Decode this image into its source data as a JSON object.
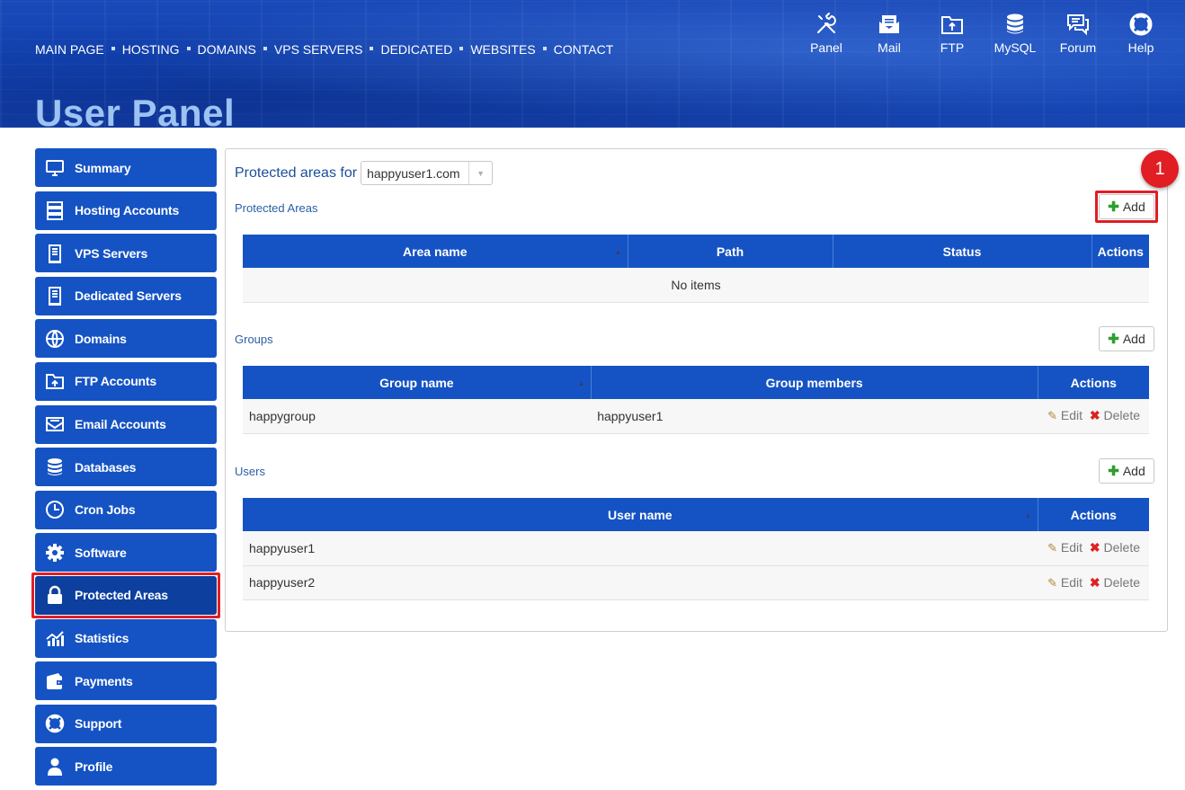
{
  "nav": {
    "items": [
      "MAIN PAGE",
      "HOSTING",
      "DOMAINS",
      "VPS SERVERS",
      "DEDICATED",
      "WEBSITES",
      "CONTACT"
    ]
  },
  "quick_links": {
    "panel": "Panel",
    "mail": "Mail",
    "ftp": "FTP",
    "mysql": "MySQL",
    "forum": "Forum",
    "help": "Help"
  },
  "page_title": "User Panel",
  "sidebar": {
    "items": [
      {
        "label": "Summary",
        "icon": "monitor-icon"
      },
      {
        "label": "Hosting Accounts",
        "icon": "server-stack-icon"
      },
      {
        "label": "VPS Servers",
        "icon": "server-tower-icon"
      },
      {
        "label": "Dedicated Servers",
        "icon": "server-tower-icon"
      },
      {
        "label": "Domains",
        "icon": "www-globe-icon"
      },
      {
        "label": "FTP Accounts",
        "icon": "folder-icon"
      },
      {
        "label": "Email Accounts",
        "icon": "envelope-icon"
      },
      {
        "label": "Databases",
        "icon": "database-icon"
      },
      {
        "label": "Cron Jobs",
        "icon": "clock-icon"
      },
      {
        "label": "Software",
        "icon": "gear-icon"
      },
      {
        "label": "Protected Areas",
        "icon": "lock-icon",
        "active": true
      },
      {
        "label": "Statistics",
        "icon": "chart-icon"
      },
      {
        "label": "Payments",
        "icon": "wallet-icon"
      },
      {
        "label": "Support",
        "icon": "lifebuoy-icon"
      },
      {
        "label": "Profile",
        "icon": "user-icon"
      }
    ]
  },
  "filter": {
    "label": "Protected areas for",
    "domain": "happyuser1.com"
  },
  "step_badge": "1",
  "protected_areas": {
    "title": "Protected Areas",
    "add_label": "Add",
    "columns": [
      "Area name",
      "Path",
      "Status",
      "Actions"
    ],
    "empty_text": "No items"
  },
  "groups": {
    "title": "Groups",
    "add_label": "Add",
    "columns": [
      "Group name",
      "Group members",
      "Actions"
    ],
    "rows": [
      {
        "name": "happygroup",
        "members": "happyuser1",
        "edit": "Edit",
        "delete": "Delete"
      }
    ]
  },
  "users": {
    "title": "Users",
    "add_label": "Add",
    "columns": [
      "User name",
      "Actions"
    ],
    "rows": [
      {
        "name": "happyuser1",
        "edit": "Edit",
        "delete": "Delete"
      },
      {
        "name": "happyuser2",
        "edit": "Edit",
        "delete": "Delete"
      }
    ]
  },
  "colors": {
    "brand_blue": "#1553c4",
    "highlight_red": "#e01e24",
    "heading_light_blue": "#9cc3f2"
  }
}
